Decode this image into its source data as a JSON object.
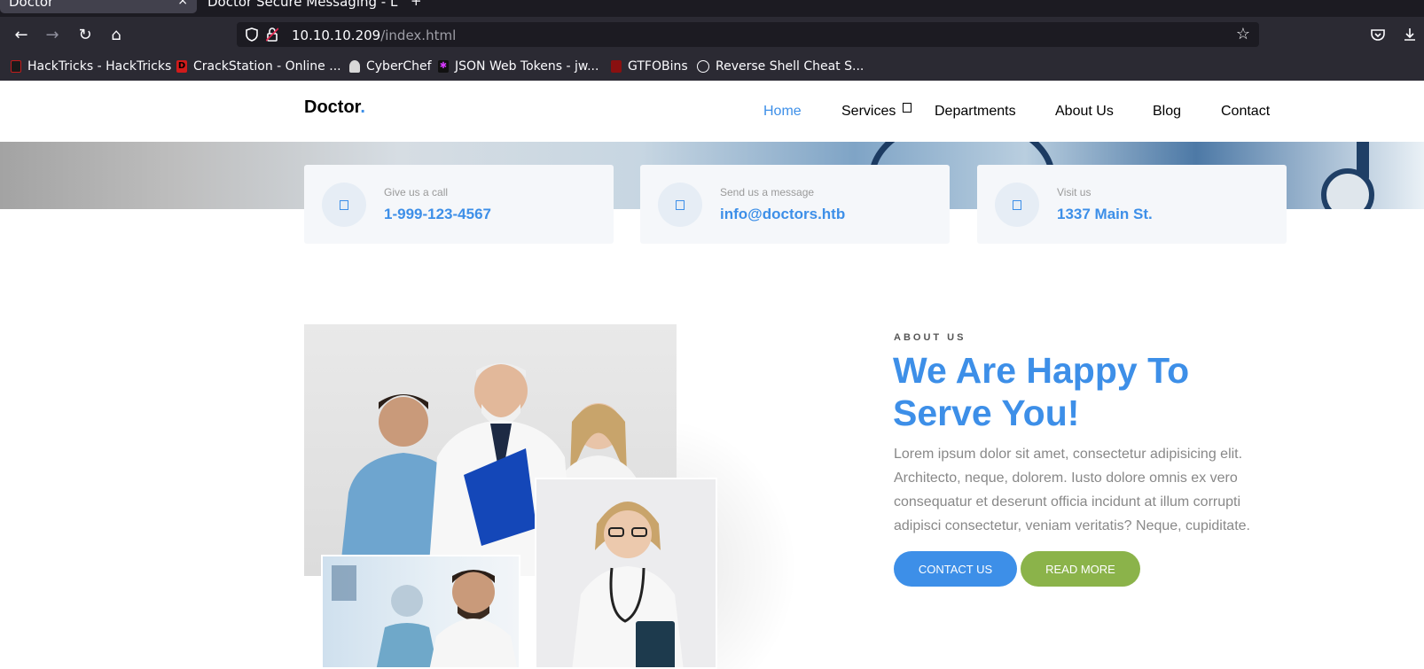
{
  "browser": {
    "tabs": [
      {
        "title": "Doctor",
        "close": "×"
      },
      {
        "title": "Doctor Secure Messaging - L"
      }
    ],
    "new_tab": "+",
    "url_host": "10.10.10.209",
    "url_path": "/index.html",
    "bookmarks": [
      {
        "label": "HackTricks - HackTricks",
        "color": "#c21c1c"
      },
      {
        "label": "CrackStation - Online ...",
        "color": "#d11b1b"
      },
      {
        "label": "CyberChef",
        "color": "#bbbbbb"
      },
      {
        "label": "JSON Web Tokens - jw...",
        "color": "#d63aff"
      },
      {
        "label": "GTFOBins",
        "color": "#8a1010"
      },
      {
        "label": "Reverse Shell Cheat S...",
        "color": "#ffffff"
      }
    ]
  },
  "site": {
    "logo": "Doctor",
    "logo_dot": ".",
    "menu": [
      "Home",
      "Services",
      "Departments",
      "About Us",
      "Blog",
      "Contact"
    ],
    "accent": "#3d8fe8",
    "contacts": [
      {
        "label": "Give us a call",
        "value": "1-999-123-4567"
      },
      {
        "label": "Send us a message",
        "value": "info@doctors.htb"
      },
      {
        "label": "Visit us",
        "value": "1337 Main St."
      }
    ],
    "about": {
      "kicker": "ABOUT US",
      "title": "We Are Happy To Serve You!",
      "text": "Lorem ipsum dolor sit amet, consectetur adipisicing elit. Architecto, neque, dolorem. Iusto dolore omnis ex vero consequatur et deserunt officia incidunt at illum corrupti adipisci consectetur, veniam veritatis? Neque, cupiditate.",
      "contact_button": "CONTACT US",
      "read_button": "READ MORE"
    }
  }
}
